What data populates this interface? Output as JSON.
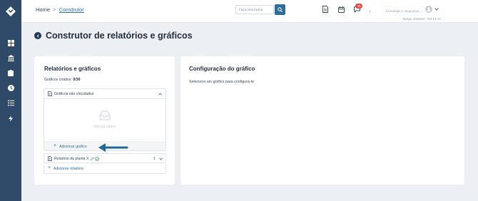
{
  "header": {
    "breadcrumb": {
      "home": "Home",
      "separator": ">",
      "current": "Construtor"
    },
    "search": {
      "placeholder": "Faça uma busca"
    },
    "notification_badge": "40",
    "user_name": "tecnologia e segurança ...",
    "time_label": "Tempo restante:",
    "time_value": "759:19:40"
  },
  "page": {
    "title": "Construtor de relatórios e gráficos"
  },
  "left_card": {
    "title": "Relatórios e gráficos",
    "count_label": "Gráficos criados:",
    "count_value": "0/30",
    "unlinked_panel_label": "Gráficos não vinculados",
    "empty_text": "Não há dados",
    "add_chart_label": "Adicionar gráfico",
    "report": {
      "name": "Relatório da planta X",
      "count": "1"
    },
    "add_report_label": "Adicionar relatório"
  },
  "right_card": {
    "title": "Configuração do gráfico",
    "hint": "Selecione um gráfico para configurá-lo"
  },
  "colors": {
    "sidebar": "#2e4a68",
    "accent": "#2f6d9a",
    "link": "#2d6fa3",
    "badge": "#e04848",
    "arrow": "#1f6a94",
    "success": "#3aa657"
  }
}
